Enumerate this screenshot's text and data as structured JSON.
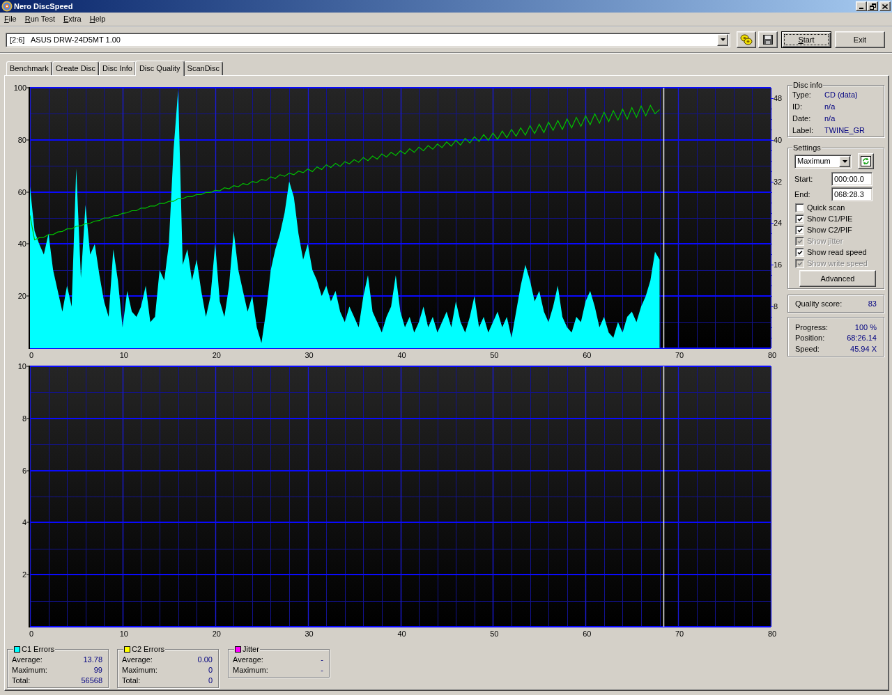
{
  "window": {
    "title": "Nero DiscSpeed"
  },
  "menu": [
    "File",
    "Run Test",
    "Extra",
    "Help"
  ],
  "toolbar": {
    "drive": "[2:6]   ASUS DRW-24D5MT 1.00",
    "buttons": [
      {
        "label": "Start",
        "default": true
      },
      {
        "label": "Exit",
        "default": false
      }
    ]
  },
  "tabs": [
    {
      "label": "Benchmark",
      "selected": false
    },
    {
      "label": "Create Disc",
      "selected": false
    },
    {
      "label": "Disc Info",
      "selected": false
    },
    {
      "label": "Disc Quality",
      "selected": true
    },
    {
      "label": "ScanDisc",
      "selected": false
    }
  ],
  "charts": [
    {
      "chart_data": {
        "type": "area",
        "grid": true,
        "xlim": [
          0,
          80
        ],
        "ylim": [
          0,
          100
        ],
        "xticks": [
          0,
          10,
          20,
          30,
          40,
          50,
          60,
          70,
          80
        ],
        "yticks": [
          20,
          40,
          60,
          80,
          100
        ],
        "y2lim": [
          0,
          50
        ],
        "y2ticks": [
          8,
          16,
          24,
          32,
          40,
          48
        ],
        "x": [
          0,
          0.5,
          1,
          1.5,
          2,
          2.5,
          3,
          3.5,
          4,
          4.5,
          5,
          5.5,
          6,
          6.5,
          7,
          7.5,
          8,
          8.5,
          9,
          9.5,
          10,
          10.5,
          11,
          11.5,
          12,
          12.5,
          13,
          13.5,
          14,
          14.5,
          15,
          15.5,
          16,
          16.5,
          17,
          17.5,
          18,
          18.5,
          19,
          19.5,
          20,
          20.5,
          21,
          21.5,
          22,
          22.5,
          23,
          23.5,
          24,
          24.5,
          25,
          25.5,
          26,
          26.5,
          27,
          27.5,
          28,
          28.5,
          29,
          29.5,
          30,
          30.5,
          31,
          31.5,
          32,
          32.5,
          33,
          33.5,
          34,
          34.5,
          35,
          35.5,
          36,
          36.5,
          37,
          37.5,
          38,
          38.5,
          39,
          39.5,
          40,
          40.5,
          41,
          41.5,
          42,
          42.5,
          43,
          43.5,
          44,
          44.5,
          45,
          45.5,
          46,
          46.5,
          47,
          47.5,
          48,
          48.5,
          49,
          49.5,
          50,
          50.5,
          51,
          51.5,
          52,
          52.5,
          53,
          53.5,
          54,
          54.5,
          55,
          55.5,
          56,
          56.5,
          57,
          57.5,
          58,
          58.5,
          59,
          59.5,
          60,
          60.5,
          61,
          61.5,
          62,
          62.5,
          63,
          63.5,
          64,
          64.5,
          65,
          65.5,
          66,
          66.5,
          67,
          67.5,
          68
        ],
        "series": [
          {
            "color": "#00ffff",
            "values": [
              62,
              45,
              40,
              36,
              44,
              30,
              22,
              14,
              24,
              16,
              69,
              27,
              55,
              36,
              40,
              28,
              18,
              12,
              38,
              26,
              8,
              22,
              14,
              12,
              16,
              24,
              10,
              12,
              30,
              26,
              40,
              76,
              99,
              32,
              38,
              26,
              34,
              22,
              12,
              20,
              40,
              18,
              12,
              24,
              45,
              30,
              22,
              14,
              20,
              8,
              2,
              14,
              30,
              38,
              44,
              52,
              64,
              58,
              44,
              34,
              40,
              30,
              26,
              20,
              24,
              18,
              22,
              14,
              10,
              16,
              12,
              8,
              20,
              28,
              14,
              10,
              6,
              12,
              16,
              28,
              14,
              8,
              12,
              6,
              10,
              16,
              8,
              12,
              6,
              10,
              14,
              8,
              18,
              10,
              6,
              12,
              20,
              8,
              12,
              6,
              10,
              14,
              8,
              12,
              4,
              14,
              24,
              32,
              26,
              18,
              22,
              14,
              10,
              16,
              24,
              12,
              8,
              6,
              12,
              10,
              18,
              22,
              16,
              8,
              12,
              6,
              4,
              10,
              6,
              12,
              14,
              10,
              16,
              20,
              26,
              37,
              34
            ]
          },
          {
            "color": "#00c000",
            "type": "line",
            "axis": "y2",
            "values": [
              25.5,
              20.8,
              21.2,
              21.3,
              21.8,
              21.8,
              22.3,
              22.4,
              22.9,
              22.9,
              23.4,
              23.5,
              23.9,
              24.0,
              24.4,
              24.5,
              25.0,
              25.0,
              25.4,
              25.5,
              25.9,
              26.0,
              26.4,
              26.4,
              26.9,
              26.9,
              27.3,
              27.3,
              27.8,
              27.8,
              28.2,
              28.2,
              28.7,
              28.7,
              29.1,
              29.1,
              29.5,
              29.5,
              29.9,
              29.9,
              30.3,
              30.2,
              30.8,
              30.6,
              31.2,
              31.0,
              31.6,
              31.4,
              32.0,
              31.8,
              32.4,
              32.2,
              32.9,
              32.6,
              33.3,
              33.0,
              33.6,
              33.3,
              34.0,
              33.7,
              34.4,
              33.9,
              34.8,
              34.3,
              35.2,
              34.7,
              35.5,
              34.9,
              35.8,
              35.4,
              36.2,
              35.7,
              36.6,
              36.0,
              36.9,
              36.3,
              37.3,
              36.7,
              37.6,
              37.0,
              37.9,
              37.3,
              38.3,
              37.6,
              38.6,
              37.9,
              38.9,
              38.2,
              39.2,
              38.5,
              39.6,
              38.8,
              39.9,
              39.0,
              40.3,
              39.4,
              40.6,
              39.7,
              41.0,
              39.9,
              41.3,
              40.1,
              41.7,
              40.4,
              42.0,
              40.7,
              42.3,
              40.9,
              42.7,
              41.2,
              43.0,
              41.4,
              43.4,
              41.8,
              43.7,
              42.0,
              44.0,
              42.3,
              44.3,
              42.6,
              44.6,
              42.9,
              45.0,
              43.2,
              45.3,
              43.5,
              45.6,
              43.8,
              45.9,
              44.0,
              46.2,
              44.3,
              46.5,
              44.6,
              46.6,
              45.0,
              45.8
            ]
          }
        ],
        "ref_lines": [
          {
            "axis": "x",
            "value": 68.4,
            "color": "#e6e6e6"
          },
          {
            "axis": "x",
            "value": 2,
            "color": "#12128e"
          },
          {
            "axis": "x",
            "value": 4,
            "color": "#12128e"
          },
          {
            "axis": "x",
            "value": 6,
            "color": "#12128e"
          },
          {
            "axis": "x",
            "value": 8,
            "color": "#12128e"
          },
          {
            "axis": "x",
            "value": 12,
            "color": "#12128e"
          },
          {
            "axis": "x",
            "value": 14,
            "color": "#12128e"
          },
          {
            "axis": "x",
            "value": 16,
            "color": "#12128e"
          },
          {
            "axis": "x",
            "value": 18,
            "color": "#12128e"
          },
          {
            "axis": "x",
            "value": 22,
            "color": "#12128e"
          },
          {
            "axis": "x",
            "value": 24,
            "color": "#12128e"
          },
          {
            "axis": "x",
            "value": 26,
            "color": "#12128e"
          },
          {
            "axis": "x",
            "value": 28,
            "color": "#12128e"
          },
          {
            "axis": "x",
            "value": 32,
            "color": "#12128e"
          },
          {
            "axis": "x",
            "value": 34,
            "color": "#12128e"
          },
          {
            "axis": "x",
            "value": 36,
            "color": "#12128e"
          },
          {
            "axis": "x",
            "value": 38,
            "color": "#12128e"
          },
          {
            "axis": "x",
            "value": 42,
            "color": "#12128e"
          },
          {
            "axis": "x",
            "value": 44,
            "color": "#12128e"
          },
          {
            "axis": "x",
            "value": 46,
            "color": "#12128e"
          },
          {
            "axis": "x",
            "value": 48,
            "color": "#12128e"
          },
          {
            "axis": "x",
            "value": 52,
            "color": "#12128e"
          },
          {
            "axis": "x",
            "value": 54,
            "color": "#12128e"
          },
          {
            "axis": "x",
            "value": 56,
            "color": "#12128e"
          },
          {
            "axis": "x",
            "value": 58,
            "color": "#12128e"
          },
          {
            "axis": "x",
            "value": 62,
            "color": "#12128e"
          },
          {
            "axis": "x",
            "value": 64,
            "color": "#12128e"
          },
          {
            "axis": "x",
            "value": 66,
            "color": "#12128e"
          },
          {
            "axis": "x",
            "value": 68,
            "color": "#12128e"
          },
          {
            "axis": "x",
            "value": 72,
            "color": "#12128e"
          },
          {
            "axis": "x",
            "value": 74,
            "color": "#12128e"
          },
          {
            "axis": "x",
            "value": 76,
            "color": "#12128e"
          },
          {
            "axis": "x",
            "value": 78,
            "color": "#12128e"
          },
          {
            "axis": "y",
            "value": 10,
            "color": "#12128e"
          },
          {
            "axis": "y",
            "value": 30,
            "color": "#12128e"
          },
          {
            "axis": "y",
            "value": 50,
            "color": "#12128e"
          },
          {
            "axis": "y",
            "value": 70,
            "color": "#12128e"
          },
          {
            "axis": "y",
            "value": 90,
            "color": "#12128e"
          }
        ]
      }
    },
    {
      "chart_data": {
        "type": "bar",
        "grid": true,
        "xlim": [
          0,
          80
        ],
        "ylim": [
          0,
          10
        ],
        "xticks": [
          0,
          10,
          20,
          30,
          40,
          50,
          60,
          70,
          80
        ],
        "yticks": [
          2,
          4,
          6,
          8,
          10
        ],
        "ref_lines": [
          {
            "axis": "x",
            "value": 68.4,
            "color": "#e6e6e6"
          },
          {
            "axis": "x",
            "value": 2,
            "color": "#12128e"
          },
          {
            "axis": "x",
            "value": 4,
            "color": "#12128e"
          },
          {
            "axis": "x",
            "value": 6,
            "color": "#12128e"
          },
          {
            "axis": "x",
            "value": 8,
            "color": "#12128e"
          },
          {
            "axis": "x",
            "value": 12,
            "color": "#12128e"
          },
          {
            "axis": "x",
            "value": 14,
            "color": "#12128e"
          },
          {
            "axis": "x",
            "value": 16,
            "color": "#12128e"
          },
          {
            "axis": "x",
            "value": 18,
            "color": "#12128e"
          },
          {
            "axis": "x",
            "value": 22,
            "color": "#12128e"
          },
          {
            "axis": "x",
            "value": 24,
            "color": "#12128e"
          },
          {
            "axis": "x",
            "value": 26,
            "color": "#12128e"
          },
          {
            "axis": "x",
            "value": 28,
            "color": "#12128e"
          },
          {
            "axis": "x",
            "value": 32,
            "color": "#12128e"
          },
          {
            "axis": "x",
            "value": 34,
            "color": "#12128e"
          },
          {
            "axis": "x",
            "value": 36,
            "color": "#12128e"
          },
          {
            "axis": "x",
            "value": 38,
            "color": "#12128e"
          },
          {
            "axis": "x",
            "value": 42,
            "color": "#12128e"
          },
          {
            "axis": "x",
            "value": 44,
            "color": "#12128e"
          },
          {
            "axis": "x",
            "value": 46,
            "color": "#12128e"
          },
          {
            "axis": "x",
            "value": 48,
            "color": "#12128e"
          },
          {
            "axis": "x",
            "value": 52,
            "color": "#12128e"
          },
          {
            "axis": "x",
            "value": 54,
            "color": "#12128e"
          },
          {
            "axis": "x",
            "value": 56,
            "color": "#12128e"
          },
          {
            "axis": "x",
            "value": 58,
            "color": "#12128e"
          },
          {
            "axis": "x",
            "value": 62,
            "color": "#12128e"
          },
          {
            "axis": "x",
            "value": 64,
            "color": "#12128e"
          },
          {
            "axis": "x",
            "value": 66,
            "color": "#12128e"
          },
          {
            "axis": "x",
            "value": 68,
            "color": "#12128e"
          },
          {
            "axis": "x",
            "value": 72,
            "color": "#12128e"
          },
          {
            "axis": "x",
            "value": 74,
            "color": "#12128e"
          },
          {
            "axis": "x",
            "value": 76,
            "color": "#12128e"
          },
          {
            "axis": "x",
            "value": 78,
            "color": "#12128e"
          },
          {
            "axis": "y",
            "value": 1,
            "color": "#12128e"
          },
          {
            "axis": "y",
            "value": 3,
            "color": "#12128e"
          },
          {
            "axis": "y",
            "value": 5,
            "color": "#12128e"
          },
          {
            "axis": "y",
            "value": 7,
            "color": "#12128e"
          },
          {
            "axis": "y",
            "value": 9,
            "color": "#12128e"
          }
        ]
      }
    }
  ],
  "stats": [
    {
      "title": "C1 Errors",
      "color": "#00ffff",
      "rows": [
        {
          "label": "Average:",
          "value": "13.78"
        },
        {
          "label": "Maximum:",
          "value": "99"
        },
        {
          "label": "Total:",
          "value": "56568"
        }
      ]
    },
    {
      "title": "C2 Errors",
      "color": "#ffff00",
      "rows": [
        {
          "label": "Average:",
          "value": "0.00"
        },
        {
          "label": "Maximum:",
          "value": "0"
        },
        {
          "label": "Total:",
          "value": "0"
        }
      ]
    },
    {
      "title": "Jitter",
      "color": "#ff00ff",
      "rows": [
        {
          "label": "Average:",
          "value": "-"
        },
        {
          "label": "Maximum:",
          "value": "-"
        }
      ]
    }
  ],
  "disc_info": {
    "title": "Disc info",
    "fields": [
      {
        "label": "Type:",
        "value": "CD (data)"
      },
      {
        "label": "ID:",
        "value": "n/a"
      },
      {
        "label": "Date:",
        "value": "n/a"
      },
      {
        "label": "Label:",
        "value": "TWINE_GR"
      }
    ]
  },
  "settings": {
    "title": "Settings",
    "mode": "Maximum",
    "range": [
      {
        "label": "Start:",
        "value": "000:00.0"
      },
      {
        "label": "End:",
        "value": "068:28.3"
      }
    ],
    "checkboxes": [
      {
        "label": "Quick scan",
        "checked": false,
        "disabled": false
      },
      {
        "label": "Show C1/PIE",
        "checked": true,
        "disabled": false
      },
      {
        "label": "Show C2/PIF",
        "checked": true,
        "disabled": false
      },
      {
        "label": "Show jitter",
        "checked": true,
        "disabled": true
      },
      {
        "label": "Show read speed",
        "checked": true,
        "disabled": false
      },
      {
        "label": "Show write speed",
        "checked": true,
        "disabled": true
      }
    ],
    "button": "Advanced"
  },
  "quality": {
    "label": "Quality score:",
    "value": "83"
  },
  "progress": [
    {
      "label": "Progress:",
      "value": "100 %"
    },
    {
      "label": "Position:",
      "value": "68:26.14"
    },
    {
      "label": "Speed:",
      "value": "45.94 X"
    }
  ]
}
